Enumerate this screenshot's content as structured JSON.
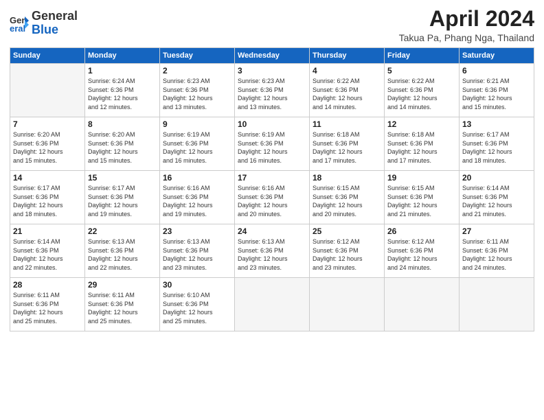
{
  "logo": {
    "general": "General",
    "blue": "Blue"
  },
  "title": "April 2024",
  "subtitle": "Takua Pa, Phang Nga, Thailand",
  "days_header": [
    "Sunday",
    "Monday",
    "Tuesday",
    "Wednesday",
    "Thursday",
    "Friday",
    "Saturday"
  ],
  "weeks": [
    [
      {
        "day": "",
        "empty": true
      },
      {
        "day": "1",
        "rise": "6:24 AM",
        "set": "6:36 PM",
        "daylight": "12 hours and 12 minutes."
      },
      {
        "day": "2",
        "rise": "6:23 AM",
        "set": "6:36 PM",
        "daylight": "12 hours and 13 minutes."
      },
      {
        "day": "3",
        "rise": "6:23 AM",
        "set": "6:36 PM",
        "daylight": "12 hours and 13 minutes."
      },
      {
        "day": "4",
        "rise": "6:22 AM",
        "set": "6:36 PM",
        "daylight": "12 hours and 14 minutes."
      },
      {
        "day": "5",
        "rise": "6:22 AM",
        "set": "6:36 PM",
        "daylight": "12 hours and 14 minutes."
      },
      {
        "day": "6",
        "rise": "6:21 AM",
        "set": "6:36 PM",
        "daylight": "12 hours and 15 minutes."
      }
    ],
    [
      {
        "day": "7",
        "rise": "6:20 AM",
        "set": "6:36 PM",
        "daylight": "12 hours and 15 minutes."
      },
      {
        "day": "8",
        "rise": "6:20 AM",
        "set": "6:36 PM",
        "daylight": "12 hours and 15 minutes."
      },
      {
        "day": "9",
        "rise": "6:19 AM",
        "set": "6:36 PM",
        "daylight": "12 hours and 16 minutes."
      },
      {
        "day": "10",
        "rise": "6:19 AM",
        "set": "6:36 PM",
        "daylight": "12 hours and 16 minutes."
      },
      {
        "day": "11",
        "rise": "6:18 AM",
        "set": "6:36 PM",
        "daylight": "12 hours and 17 minutes."
      },
      {
        "day": "12",
        "rise": "6:18 AM",
        "set": "6:36 PM",
        "daylight": "12 hours and 17 minutes."
      },
      {
        "day": "13",
        "rise": "6:17 AM",
        "set": "6:36 PM",
        "daylight": "12 hours and 18 minutes."
      }
    ],
    [
      {
        "day": "14",
        "rise": "6:17 AM",
        "set": "6:36 PM",
        "daylight": "12 hours and 18 minutes."
      },
      {
        "day": "15",
        "rise": "6:17 AM",
        "set": "6:36 PM",
        "daylight": "12 hours and 19 minutes."
      },
      {
        "day": "16",
        "rise": "6:16 AM",
        "set": "6:36 PM",
        "daylight": "12 hours and 19 minutes."
      },
      {
        "day": "17",
        "rise": "6:16 AM",
        "set": "6:36 PM",
        "daylight": "12 hours and 20 minutes."
      },
      {
        "day": "18",
        "rise": "6:15 AM",
        "set": "6:36 PM",
        "daylight": "12 hours and 20 minutes."
      },
      {
        "day": "19",
        "rise": "6:15 AM",
        "set": "6:36 PM",
        "daylight": "12 hours and 21 minutes."
      },
      {
        "day": "20",
        "rise": "6:14 AM",
        "set": "6:36 PM",
        "daylight": "12 hours and 21 minutes."
      }
    ],
    [
      {
        "day": "21",
        "rise": "6:14 AM",
        "set": "6:36 PM",
        "daylight": "12 hours and 22 minutes."
      },
      {
        "day": "22",
        "rise": "6:13 AM",
        "set": "6:36 PM",
        "daylight": "12 hours and 22 minutes."
      },
      {
        "day": "23",
        "rise": "6:13 AM",
        "set": "6:36 PM",
        "daylight": "12 hours and 23 minutes."
      },
      {
        "day": "24",
        "rise": "6:13 AM",
        "set": "6:36 PM",
        "daylight": "12 hours and 23 minutes."
      },
      {
        "day": "25",
        "rise": "6:12 AM",
        "set": "6:36 PM",
        "daylight": "12 hours and 23 minutes."
      },
      {
        "day": "26",
        "rise": "6:12 AM",
        "set": "6:36 PM",
        "daylight": "12 hours and 24 minutes."
      },
      {
        "day": "27",
        "rise": "6:11 AM",
        "set": "6:36 PM",
        "daylight": "12 hours and 24 minutes."
      }
    ],
    [
      {
        "day": "28",
        "rise": "6:11 AM",
        "set": "6:36 PM",
        "daylight": "12 hours and 25 minutes."
      },
      {
        "day": "29",
        "rise": "6:11 AM",
        "set": "6:36 PM",
        "daylight": "12 hours and 25 minutes."
      },
      {
        "day": "30",
        "rise": "6:10 AM",
        "set": "6:36 PM",
        "daylight": "12 hours and 25 minutes."
      },
      {
        "day": "",
        "empty": true
      },
      {
        "day": "",
        "empty": true
      },
      {
        "day": "",
        "empty": true
      },
      {
        "day": "",
        "empty": true
      }
    ]
  ]
}
